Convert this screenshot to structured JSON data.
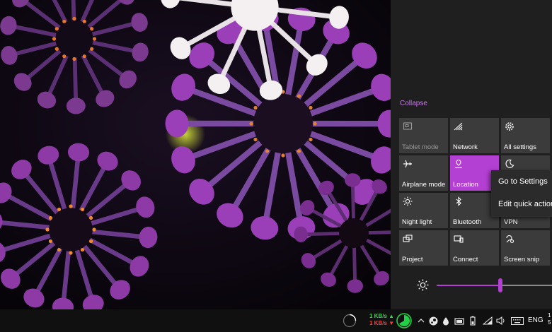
{
  "action_center": {
    "collapse_label": "Collapse",
    "tiles": [
      {
        "label": "Tablet mode",
        "icon": "tablet-mode-icon",
        "state": "disabled"
      },
      {
        "label": "Network",
        "icon": "network-icon",
        "state": "off"
      },
      {
        "label": "All settings",
        "icon": "gear-icon",
        "state": "off"
      },
      {
        "label": "Airplane mode",
        "icon": "airplane-icon",
        "state": "off"
      },
      {
        "label": "Location",
        "icon": "location-icon",
        "state": "on"
      },
      {
        "label": "",
        "icon": "moon-icon",
        "state": "off"
      },
      {
        "label": "Night light",
        "icon": "sun-icon",
        "state": "off"
      },
      {
        "label": "Bluetooth",
        "icon": "bluetooth-icon",
        "state": "off"
      },
      {
        "label": "VPN",
        "icon": "vpn-icon",
        "state": "off"
      },
      {
        "label": "Project",
        "icon": "project-icon",
        "state": "off"
      },
      {
        "label": "Connect",
        "icon": "connect-icon",
        "state": "off"
      },
      {
        "label": "Screen snip",
        "icon": "screen-snip-icon",
        "state": "off"
      }
    ],
    "brightness": {
      "icon": "brightness-icon",
      "value_percent": 55
    }
  },
  "context_menu": {
    "items": [
      "Go to Settings",
      "Edit quick actions"
    ]
  },
  "taskbar": {
    "upload_speed": "1 KB/s",
    "download_speed": "1 KB/s",
    "language": "ENG",
    "clock_partial": "1\n5"
  },
  "colors": {
    "accent": "#b43fd3",
    "tile": "#3b3b3b",
    "panel": "#1f1f1f",
    "taskbar": "#101010",
    "upload": "#2dd84a",
    "download": "#ff3d3d"
  }
}
